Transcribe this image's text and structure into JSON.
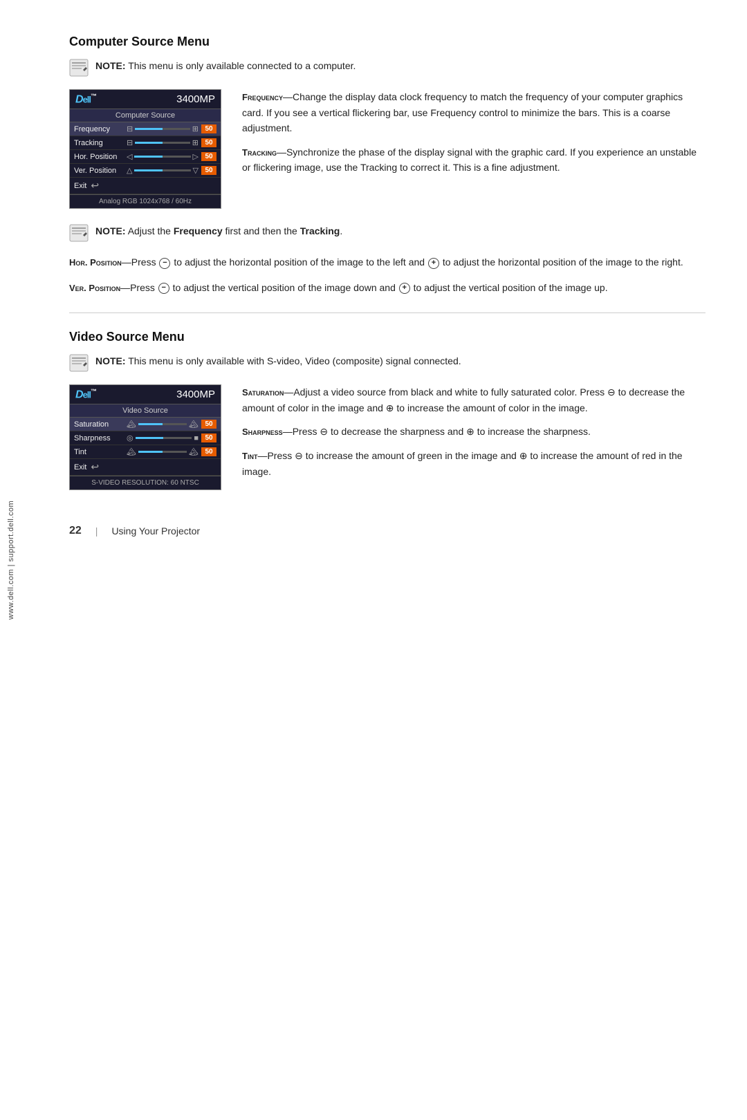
{
  "side_text": "www.dell.com | support.dell.com",
  "computer_source": {
    "section_title": "Computer Source Menu",
    "note1": {
      "label": "NOTE:",
      "text": "This menu is only available connected to a computer."
    },
    "menu": {
      "logo": "Dell",
      "logo_tm": "™",
      "model": "3400MP",
      "subtitle": "Computer Source",
      "rows": [
        {
          "label": "Frequency",
          "value": "50"
        },
        {
          "label": "Tracking",
          "value": "50"
        },
        {
          "label": "Hor. Position",
          "value": "50"
        },
        {
          "label": "Ver. Position",
          "value": "50"
        }
      ],
      "exit_label": "Exit",
      "footer": "Analog RGB 1024x768 / 60Hz"
    },
    "frequency_term": "Frequency",
    "frequency_desc": "—Change the display data clock frequency to match the frequency of your computer graphics card. If you see a vertical flickering bar, use Frequency control to minimize the bars. This is a coarse adjustment.",
    "tracking_term": "Tracking",
    "tracking_desc": "—Synchronize the phase of the display signal with the graphic card. If you experience an unstable or flickering image, use the Tracking to correct it. This is a fine adjustment.",
    "note2": {
      "label": "NOTE:",
      "text": "Adjust the Frequency first and then the Tracking."
    },
    "hor_position_term": "Hor. Position",
    "hor_position_desc": "—Press ⊖ to adjust the horizontal position of the image to the left and ⊕ to adjust the horizontal position of the image to the right.",
    "ver_position_term": "Ver. Position",
    "ver_position_desc": "—Press ⊖ to adjust the vertical position of the image down and ⊕ to adjust the vertical position of the image up."
  },
  "video_source": {
    "section_title": "Video Source Menu",
    "note1": {
      "label": "NOTE:",
      "text": "This menu is only available with S-video, Video (composite) signal connected."
    },
    "menu": {
      "logo": "Dell",
      "logo_tm": "™",
      "model": "3400MP",
      "subtitle": "Video Source",
      "rows": [
        {
          "label": "Saturation",
          "value": "50"
        },
        {
          "label": "Sharpness",
          "value": "50"
        },
        {
          "label": "Tint",
          "value": "50"
        }
      ],
      "exit_label": "Exit",
      "footer": "S-VIDEO RESOLUTION: 60 NTSC"
    },
    "saturation_term": "Saturation",
    "saturation_desc": "—Adjust a video source from black and white to fully saturated color. Press ⊖ to decrease the amount of color in the image and ⊕ to increase the amount of color in the image.",
    "sharpness_term": "Sharpness",
    "sharpness_desc": "—Press ⊖ to decrease the sharpness and ⊕ to increase the sharpness.",
    "tint_term": "Tint",
    "tint_desc": "—Press ⊖ to increase the amount of green in the image and ⊕ to increase the amount of red in the image."
  },
  "footer": {
    "page_number": "22",
    "separator": "|",
    "text": "Using Your Projector"
  }
}
